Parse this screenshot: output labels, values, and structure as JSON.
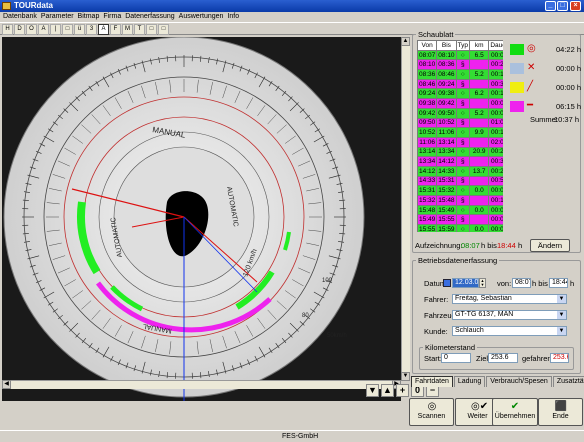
{
  "window": {
    "title": "TOURdata"
  },
  "menu": [
    "Datenbank",
    "Parameter",
    "Bitmap",
    "Firma",
    "Datenerfassung",
    "Auswertungen",
    "Info"
  ],
  "toolbar": [
    "H",
    "D",
    "O",
    "A",
    "|",
    "□",
    "ü",
    "3",
    "A",
    "F",
    "M",
    "T",
    "□",
    "□"
  ],
  "disc": {
    "labels": [
      "MANUAL",
      "AUTOMATIC",
      "MANUAL",
      "AUTOMATIC",
      "120 km/h",
      "80",
      "100",
      "50km/h"
    ]
  },
  "schaublatt": {
    "title": "Schaublatt",
    "columns": [
      "Von",
      "Bis",
      "Typ",
      "km",
      "Dauer"
    ],
    "rows": [
      {
        "von": "08:07",
        "bis": "08:10",
        "typ": "○",
        "km": "6.5",
        "dauer": "00:03",
        "color": "#33dd33"
      },
      {
        "von": "08:10",
        "bis": "08:36",
        "typ": "§",
        "km": "",
        "dauer": "00:26",
        "color": "#ee22ee"
      },
      {
        "von": "08:36",
        "bis": "08:46",
        "typ": "○",
        "km": "5.2",
        "dauer": "00:10",
        "color": "#33dd33"
      },
      {
        "von": "08:46",
        "bis": "09:24",
        "typ": "§",
        "km": "",
        "dauer": "00:38",
        "color": "#ee22ee"
      },
      {
        "von": "09:24",
        "bis": "09:38",
        "typ": "○",
        "km": "6.2",
        "dauer": "00:14",
        "color": "#33dd33"
      },
      {
        "von": "09:38",
        "bis": "09:42",
        "typ": "§",
        "km": "",
        "dauer": "00:04",
        "color": "#ee22ee"
      },
      {
        "von": "09:42",
        "bis": "09:50",
        "typ": "○",
        "km": "5.2",
        "dauer": "00:08",
        "color": "#33dd33"
      },
      {
        "von": "09:50",
        "bis": "10:52",
        "typ": "§",
        "km": "",
        "dauer": "01:02",
        "color": "#ee22ee"
      },
      {
        "von": "10:52",
        "bis": "11:06",
        "typ": "○",
        "km": "9.9",
        "dauer": "00:14",
        "color": "#33dd33"
      },
      {
        "von": "11:06",
        "bis": "13:14",
        "typ": "§",
        "km": "",
        "dauer": "02:08",
        "color": "#ee22ee"
      },
      {
        "von": "13:14",
        "bis": "13:34",
        "typ": "○",
        "km": "20.9",
        "dauer": "00:20",
        "color": "#33dd33"
      },
      {
        "von": "13:34",
        "bis": "14:12",
        "typ": "§",
        "km": "",
        "dauer": "00:38",
        "color": "#ee22ee"
      },
      {
        "von": "14:12",
        "bis": "14:33",
        "typ": "○",
        "km": "13.7",
        "dauer": "00:21",
        "color": "#33dd33"
      },
      {
        "von": "14:33",
        "bis": "15:31",
        "typ": "§",
        "km": "",
        "dauer": "00:58",
        "color": "#ee22ee"
      },
      {
        "von": "15:31",
        "bis": "15:32",
        "typ": "○",
        "km": "0.0",
        "dauer": "00:01",
        "color": "#33dd33"
      },
      {
        "von": "15:32",
        "bis": "15:48",
        "typ": "§",
        "km": "",
        "dauer": "00:16",
        "color": "#ee22ee"
      },
      {
        "von": "15:48",
        "bis": "15:49",
        "typ": "○",
        "km": "0.0",
        "dauer": "00:01",
        "color": "#33dd33"
      },
      {
        "von": "15:49",
        "bis": "15:55",
        "typ": "§",
        "km": "",
        "dauer": "00:06",
        "color": "#ee22ee"
      },
      {
        "von": "15:55",
        "bis": "15:59",
        "typ": "○",
        "km": "0.0",
        "dauer": "00:04",
        "color": "#33dd33"
      },
      {
        "von": "15:59",
        "bis": "16:03",
        "typ": "§",
        "km": "",
        "dauer": "00:04",
        "color": "#ee22ee"
      },
      {
        "von": "16:03",
        "bis": "18:44",
        "typ": "○",
        "km": "185.4",
        "dauer": "02:41",
        "color": "#33dd33"
      }
    ],
    "legend": [
      {
        "color": "#11dd11",
        "value": "04:22 h",
        "icon": "◎"
      },
      {
        "color": "#aac0dd",
        "value": "00:00 h",
        "icon": "✕"
      },
      {
        "color": "#f0ee10",
        "value": "00:00 h",
        "icon": "╱"
      },
      {
        "color": "#ee22ee",
        "value": "06:15 h",
        "icon": "━"
      }
    ],
    "summe_label": "Summe:",
    "summe_value": "10:37 h",
    "aufzeichnung_label": "Aufzeichnung:",
    "aufzeichnung_von": "08:07",
    "aufzeichnung_h1": "h bis",
    "aufzeichnung_bis": "18:44",
    "aufzeichnung_h2": "h",
    "andern_button": "Ändern"
  },
  "betrieb": {
    "title": "Betriebsdatenerfassung",
    "datum_label": "Datum:",
    "datum_value": "12.03.02",
    "von_label": "von:",
    "von_value": "08:07",
    "h_bis": "h  bis",
    "bis_value": "18:44",
    "h": "h",
    "fahrer_label": "Fahrer:",
    "fahrer_value": "Freitag, Sebastian",
    "fahrzeug_label": "Fahrzeug:",
    "fahrzeug_value": "GT-TG 6137, MAN",
    "kunde_label": "Kunde:",
    "kunde_value": "Schlauch",
    "km_title": "Kilometerstand",
    "start_label": "Start:",
    "start_value": "0",
    "ziel_label": "Ziel:",
    "ziel_value": "253.6",
    "gefahren_label": "gefahren:",
    "gefahren_value": "253.6"
  },
  "tabs": [
    "Fahrtdaten",
    "Ladung",
    "Verbrauch/Spesen",
    "Zusatztätigkeit"
  ],
  "buttons": {
    "scannen": "Scannen",
    "weiter": "Weiter",
    "ubernehmen": "Übernehmen",
    "ende": "Ende"
  },
  "zoom": {
    "value": "0"
  },
  "status": {
    "company": "FES-GmbH"
  }
}
